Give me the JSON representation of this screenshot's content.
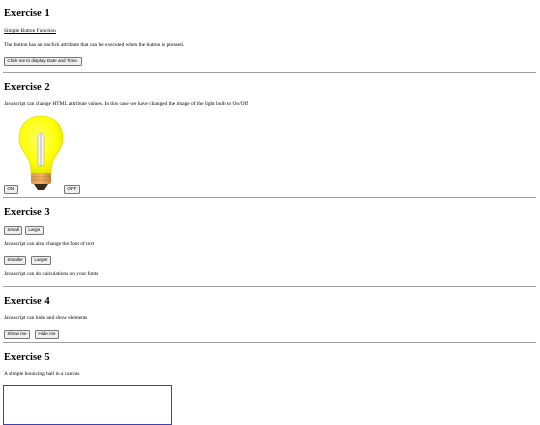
{
  "ex1": {
    "title": "Exercise 1",
    "link": "Simple Button Function",
    "desc": "The button has an onclick attribute that can be executed when the button is pressed.",
    "button": "Click me to display Date and Time."
  },
  "ex2": {
    "title": "Exercise 2",
    "desc": "Javascript can change HTML attribute values. In this case we have changed the image of the light bulb to On/Off",
    "on_button": "ON",
    "off_button": "OFF",
    "bulb_color": "#ffff00"
  },
  "ex3": {
    "title": "Exercise 3",
    "small_button": "Small",
    "large_button": "Large",
    "desc1": "Javascript can also change the font of text",
    "smaller_button": "Smaller",
    "larger_button": "Larger",
    "desc2": "Javascript can do calculations on your fonts"
  },
  "ex4": {
    "title": "Exercise 4",
    "desc": "Javascript can hide and show elements",
    "show_button": "Show me",
    "hide_button": "Hide me"
  },
  "ex5": {
    "title": "Exercise 5",
    "desc": "A simple bouncing ball in a canvas",
    "canvas_border_color": "#3a45b5"
  }
}
